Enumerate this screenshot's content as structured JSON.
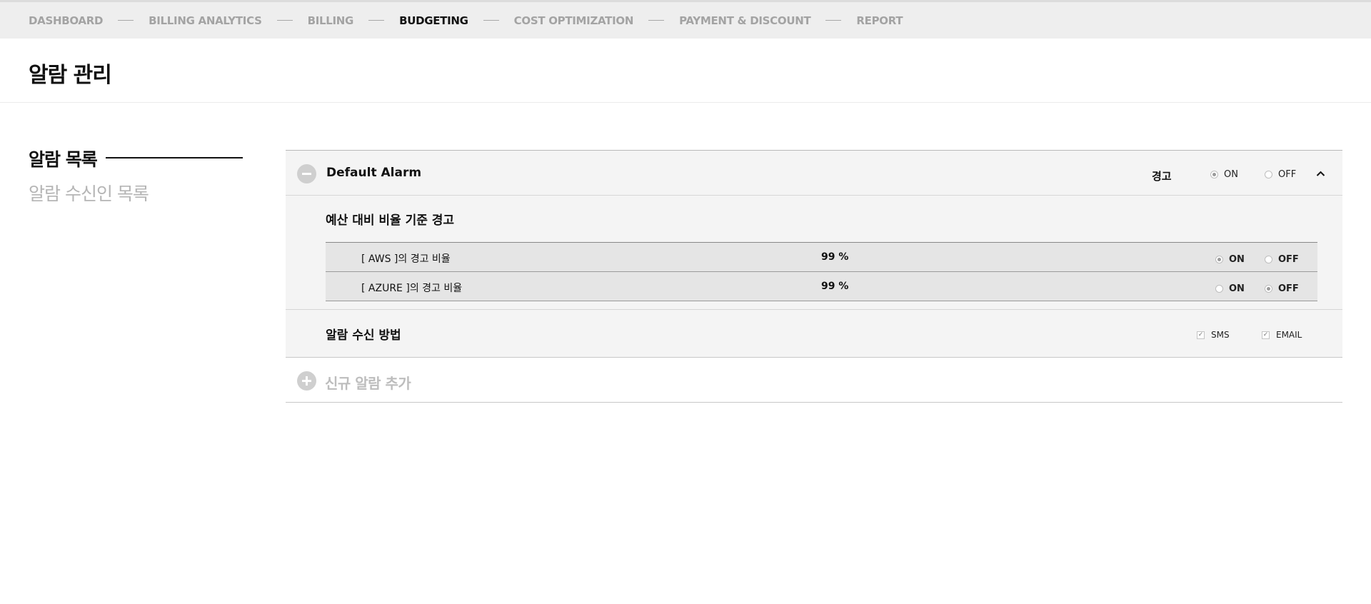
{
  "nav": {
    "items": [
      {
        "label": "DASHBOARD"
      },
      {
        "label": "BILLING ANALYTICS"
      },
      {
        "label": "BILLING"
      },
      {
        "label": "BUDGETING"
      },
      {
        "label": "COST OPTIMIZATION"
      },
      {
        "label": "PAYMENT & DISCOUNT"
      },
      {
        "label": "REPORT"
      }
    ],
    "active": "BUDGETING"
  },
  "page": {
    "title": "알람 관리"
  },
  "sidebar": {
    "active_label": "알람 목록",
    "inactive_label": "알람 수신인 목록"
  },
  "alarm": {
    "name": "Default Alarm",
    "warn_label": "경고",
    "warn_on_label": "ON",
    "warn_off_label": "OFF",
    "warn_state": "ON",
    "collapse_icon": "chevron-up-icon",
    "toggle_icon": "minus-circle-icon",
    "ratio_section_title": "예산 대비 비율 기준 경고",
    "ratio_rows": [
      {
        "label": "[ AWS ]의 경고 비율",
        "value": "99 %",
        "on_label": "ON",
        "off_label": "OFF",
        "state": "ON"
      },
      {
        "label": "[ AZURE ]의 경고 비율",
        "value": "99 %",
        "on_label": "ON",
        "off_label": "OFF",
        "state": "OFF"
      }
    ],
    "receive_section_title": "알람 수신 방법",
    "receive_methods": [
      {
        "label": "SMS",
        "checked": true
      },
      {
        "label": "EMAIL",
        "checked": true
      }
    ]
  },
  "add_alarm": {
    "label": "신규 알람 추가",
    "icon": "plus-circle-icon"
  },
  "colors": {
    "active_text": "#111111",
    "inactive_text": "#a3a3a3",
    "panel_bg": "#f4f4f4"
  }
}
